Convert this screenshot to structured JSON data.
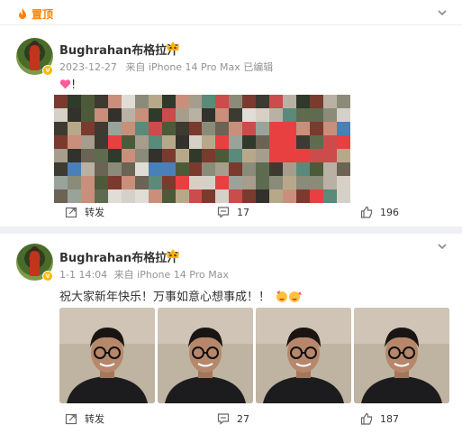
{
  "colors": {
    "accent": "#ff8200",
    "meta_text": "#939393",
    "background": "#eef0f3"
  },
  "posts": [
    {
      "pinned": true,
      "pin_label": "置顶",
      "user": {
        "name": "Bughrahan布格拉汗"
      },
      "meta": {
        "date": "2023-12-27",
        "source": "来自 iPhone 14 Pro Max",
        "edited": "已编辑"
      },
      "text": "!",
      "media": {
        "type": "mosaic-image"
      },
      "actions": {
        "repost_label": "转发",
        "comments": "17",
        "likes": "196"
      }
    },
    {
      "pinned": false,
      "user": {
        "name": "Bughrahan布格拉汗"
      },
      "meta": {
        "date": "1-1 14:04",
        "source": "来自 iPhone 14 Pro Max"
      },
      "text": "祝大家新年快乐！万事如意心想事成！！",
      "media": {
        "type": "photo-grid",
        "count": 4
      },
      "actions": {
        "repost_label": "转发",
        "comments": "27",
        "likes": "187"
      }
    }
  ]
}
